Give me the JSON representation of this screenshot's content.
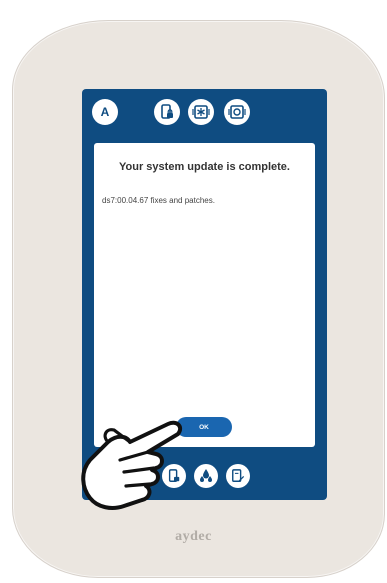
{
  "device": {
    "brand": "aydec"
  },
  "screen": {
    "topbar": {
      "avatar_letter": "A",
      "icons": [
        "phone-lock-icon",
        "snowflake-box-icon",
        "camera-frame-icon"
      ]
    },
    "dialog": {
      "title": "Your system update is complete.",
      "message": "ds7:00.04.67 fixes and patches.",
      "ok_label": "OK"
    },
    "bottombar": {
      "icons": [
        "phone-lock-icon",
        "droplets-icon",
        "document-edit-icon"
      ]
    }
  },
  "colors": {
    "screen_blue": "#0f4c81",
    "button_blue": "#1a66b0",
    "device_shell": "#ebe6e0"
  }
}
